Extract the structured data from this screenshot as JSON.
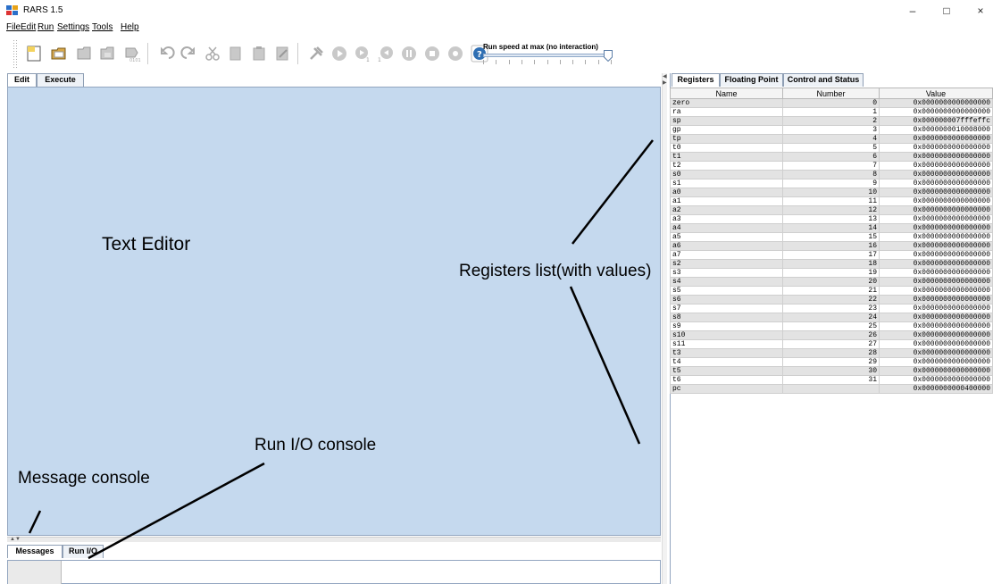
{
  "window": {
    "title": "RARS 1.5",
    "minimize": "–",
    "maximize": "□",
    "close": "×"
  },
  "menu": [
    "File",
    "Edit",
    "Run",
    "Settings",
    "Tools",
    "Help"
  ],
  "toolbar": {
    "speed_label": "Run speed at max (no interaction)",
    "speed_fraction": 1.0,
    "icons": [
      "new-file-icon",
      "open-file-icon",
      "save-file-icon",
      "save-as-icon",
      "dump-memory-icon",
      "undo-icon",
      "redo-icon",
      "cut-icon",
      "copy-icon",
      "paste-icon",
      "find-replace-icon",
      "assemble-icon",
      "run-icon",
      "step-icon",
      "backstep-icon",
      "pause-icon",
      "stop-icon",
      "reset-icon",
      "help-icon"
    ]
  },
  "left_tabs": {
    "edit": "Edit",
    "execute": "Execute"
  },
  "bottom_tabs": {
    "messages": "Messages",
    "run_io": "Run I/O"
  },
  "right_tabs": {
    "registers": "Registers",
    "floating": "Floating Point",
    "control": "Control and Status"
  },
  "registers": {
    "columns": [
      "Name",
      "Number",
      "Value"
    ],
    "rows": [
      [
        "zero",
        "0",
        "0x0000000000000000"
      ],
      [
        "ra",
        "1",
        "0x0000000000000000"
      ],
      [
        "sp",
        "2",
        "0x000000007fffeffc"
      ],
      [
        "gp",
        "3",
        "0x0000000010008000"
      ],
      [
        "tp",
        "4",
        "0x0000000000000000"
      ],
      [
        "t0",
        "5",
        "0x0000000000000000"
      ],
      [
        "t1",
        "6",
        "0x0000000000000000"
      ],
      [
        "t2",
        "7",
        "0x0000000000000000"
      ],
      [
        "s0",
        "8",
        "0x0000000000000000"
      ],
      [
        "s1",
        "9",
        "0x0000000000000000"
      ],
      [
        "a0",
        "10",
        "0x0000000000000000"
      ],
      [
        "a1",
        "11",
        "0x0000000000000000"
      ],
      [
        "a2",
        "12",
        "0x0000000000000000"
      ],
      [
        "a3",
        "13",
        "0x0000000000000000"
      ],
      [
        "a4",
        "14",
        "0x0000000000000000"
      ],
      [
        "a5",
        "15",
        "0x0000000000000000"
      ],
      [
        "a6",
        "16",
        "0x0000000000000000"
      ],
      [
        "a7",
        "17",
        "0x0000000000000000"
      ],
      [
        "s2",
        "18",
        "0x0000000000000000"
      ],
      [
        "s3",
        "19",
        "0x0000000000000000"
      ],
      [
        "s4",
        "20",
        "0x0000000000000000"
      ],
      [
        "s5",
        "21",
        "0x0000000000000000"
      ],
      [
        "s6",
        "22",
        "0x0000000000000000"
      ],
      [
        "s7",
        "23",
        "0x0000000000000000"
      ],
      [
        "s8",
        "24",
        "0x0000000000000000"
      ],
      [
        "s9",
        "25",
        "0x0000000000000000"
      ],
      [
        "s10",
        "26",
        "0x0000000000000000"
      ],
      [
        "s11",
        "27",
        "0x0000000000000000"
      ],
      [
        "t3",
        "28",
        "0x0000000000000000"
      ],
      [
        "t4",
        "29",
        "0x0000000000000000"
      ],
      [
        "t5",
        "30",
        "0x0000000000000000"
      ],
      [
        "t6",
        "31",
        "0x0000000000000000"
      ],
      [
        "pc",
        "",
        "0x0000000000400000"
      ]
    ]
  },
  "annotations": {
    "text_editor": "Text Editor",
    "registers_list": "Registers list(with values)",
    "run_io_console": "Run I/O console",
    "message_console": "Message console"
  },
  "colors": {
    "editor_bg": "#c5d9ee",
    "tab_border": "#8f9fb5"
  }
}
